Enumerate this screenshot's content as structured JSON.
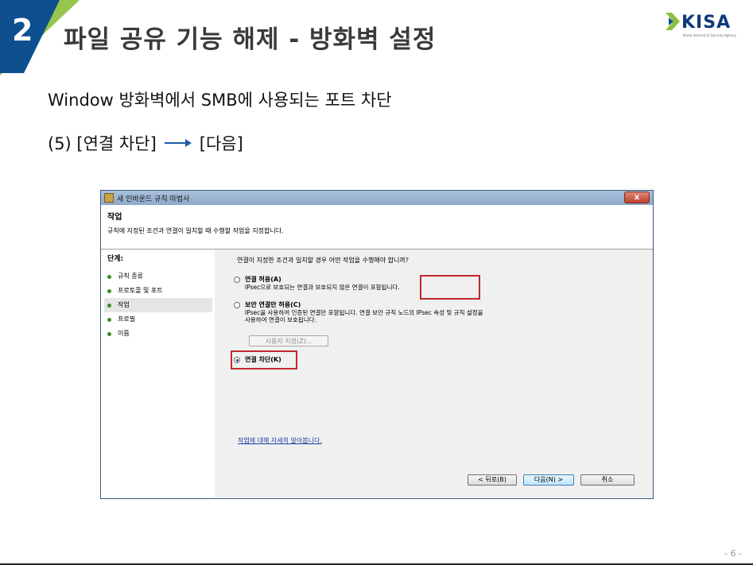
{
  "slide": {
    "number": "2",
    "title": "파일 공유 기능 해제 - 방화벽 설정",
    "logo_text": "KISA",
    "logo_subtext": "Korea Internet & Security Agency",
    "subtitle": "Window 방화벽에서 SMB에 사용되는 포트 차단",
    "step_prefix": "(5) [연결 차단]",
    "step_suffix": "[다음]",
    "page_number": "- 6 -"
  },
  "colors": {
    "header_bar": "#0e4f8f",
    "accent_green": "#8dbf3a",
    "highlight_red": "#c0272d",
    "arrow_blue": "#1f5fa8"
  },
  "dialog": {
    "title": "새 인바운드 규칙 마법사",
    "close_label": "x",
    "header_title": "작업",
    "header_desc": "규칙에 지정된 조건과 연결이 일치할 때 수행할 작업을 지정합니다.",
    "steps_heading": "단계:",
    "steps": [
      {
        "label": "규칙 종류"
      },
      {
        "label": "프로토콜 및 포트"
      },
      {
        "label": "작업"
      },
      {
        "label": "프로필"
      },
      {
        "label": "이름"
      }
    ],
    "current_step": "작업",
    "question": "연결이 지정한 조건과 일치할 경우 어떤 작업을 수행해야 합니까?",
    "options": [
      {
        "label": "연결 허용(A)",
        "desc": "IPsec으로 보호되는 연결과 보호되지 않은 연결이 포함됩니다.",
        "checked": false
      },
      {
        "label": "보안 연결만 허용(C)",
        "desc_line1": "IPsec을 사용하여 인증된 연결만 포함됩니다. 연결 보안 규칙 노드의 IPsec 속성 및 규칙 설정을",
        "desc_line2": "사용하여 연결이 보호됩니다.",
        "checked": false
      },
      {
        "label": "연결 차단(K)",
        "checked": true
      }
    ],
    "custom_button": "사용자 지정(Z)...",
    "learn_more": "작업에 대해 자세히 알아봅니다.",
    "back_button": "< 뒤로(B)",
    "next_button": "다음(N) >",
    "cancel_button": "취소"
  }
}
